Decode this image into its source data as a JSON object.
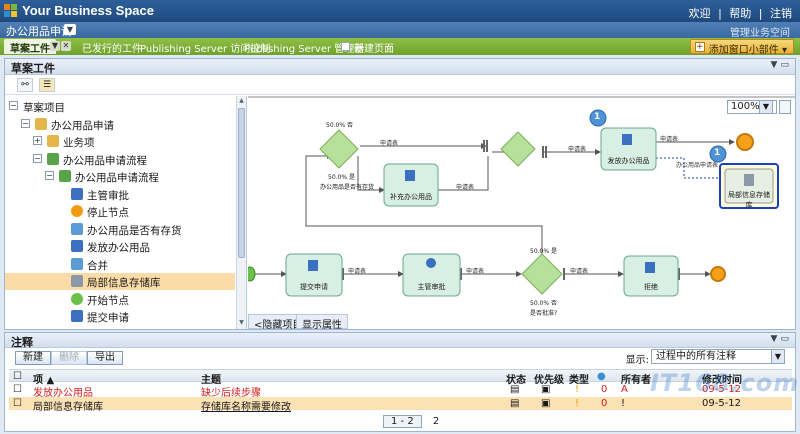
{
  "topbar": {
    "brand": "Your Business Space",
    "links": [
      "欢迎",
      "|",
      "帮助",
      "|",
      "注销"
    ]
  },
  "subbar": {
    "site": "办公用品申请",
    "manage": "管理业务空间"
  },
  "tabs": [
    {
      "label": "草案工件",
      "active": true
    },
    {
      "label": "已发行的工件",
      "active": false
    },
    {
      "label": "Publishing Server 访问控制",
      "active": false
    },
    {
      "label": "Publishing Server 管理器",
      "active": false
    },
    {
      "label": "新建页面",
      "active": false
    }
  ],
  "add_widget": "添加窗口小部件",
  "panel": {
    "title": "草案工件"
  },
  "tree": [
    {
      "label": "草案项目",
      "indent": 0,
      "exp": "−",
      "icon": "none"
    },
    {
      "label": "办公用品申请",
      "indent": 1,
      "exp": "−",
      "icon": "folder"
    },
    {
      "label": "业务项",
      "indent": 2,
      "exp": "+",
      "icon": "folder"
    },
    {
      "label": "办公用品申请流程",
      "indent": 2,
      "exp": "−",
      "icon": "process"
    },
    {
      "label": "办公用品申请流程",
      "indent": 3,
      "exp": "−",
      "icon": "process"
    },
    {
      "label": "主管审批",
      "indent": 4,
      "exp": "",
      "icon": "person"
    },
    {
      "label": "停止节点",
      "indent": 4,
      "exp": "",
      "icon": "stop"
    },
    {
      "label": "办公用品是否有存货",
      "indent": 4,
      "exp": "",
      "icon": "decision"
    },
    {
      "label": "发放办公用品",
      "indent": 4,
      "exp": "",
      "icon": "task"
    },
    {
      "label": "合并",
      "indent": 4,
      "exp": "",
      "icon": "merge"
    },
    {
      "label": "局部信息存储库",
      "indent": 4,
      "exp": "",
      "icon": "repo",
      "selected": true
    },
    {
      "label": "开始节点",
      "indent": 4,
      "exp": "",
      "icon": "start"
    },
    {
      "label": "提交申请",
      "indent": 4,
      "exp": "",
      "icon": "task"
    }
  ],
  "canvas": {
    "zoom": "100%",
    "tasks": [
      {
        "label": "补充办公用品"
      },
      {
        "label": "发放办公用品"
      },
      {
        "label": "局部信息存储库"
      },
      {
        "label": "提交申请"
      },
      {
        "label": "主管审批"
      },
      {
        "label": "拒绝"
      }
    ],
    "edge_labels": [
      "申请表",
      "申请表",
      "申请表",
      "申请表",
      "申请表",
      "申请表",
      "申请表"
    ],
    "gateway_labels": [
      "否",
      "是",
      "办公用品是否有存货",
      "是",
      "否",
      "是否批准?"
    ],
    "percent_labels": [
      "50.0%",
      "50.0%",
      "50.0%",
      "50.0%"
    ],
    "badges": [
      "1",
      "1"
    ],
    "side_note": "办公用品申请表"
  },
  "bottom_tabs": [
    "<隐藏项目",
    "显示属性"
  ],
  "notes": {
    "title": "注释",
    "buttons": {
      "new": "新建",
      "delete": "删除",
      "export": "导出"
    },
    "show_label": "显示:",
    "show_value": "过程中的所有注释",
    "columns": [
      "项 ▲",
      "主题",
      "状态",
      "优先级",
      "类型",
      "",
      "所有者",
      "修改时间"
    ],
    "rows": [
      {
        "item": "发放办公用品",
        "subject": "缺少后续步骤",
        "count": "0",
        "owner": "A",
        "time": "09-5-12",
        "red": true
      },
      {
        "item": "局部信息存储库",
        "subject": "存储库名称需要修改",
        "count": "0",
        "owner": "!",
        "time": "09-5-12",
        "red": false
      }
    ],
    "pager": {
      "current": "1 - 2",
      "total": "2"
    }
  },
  "watermark": "IT168.com",
  "colors": {
    "accent": "#6fa12d",
    "brand": "#1f4a7d",
    "selected": "#fbdca7",
    "task": "#d8efe4",
    "gateway": "#a7d58a",
    "stop": "#f39c12"
  }
}
